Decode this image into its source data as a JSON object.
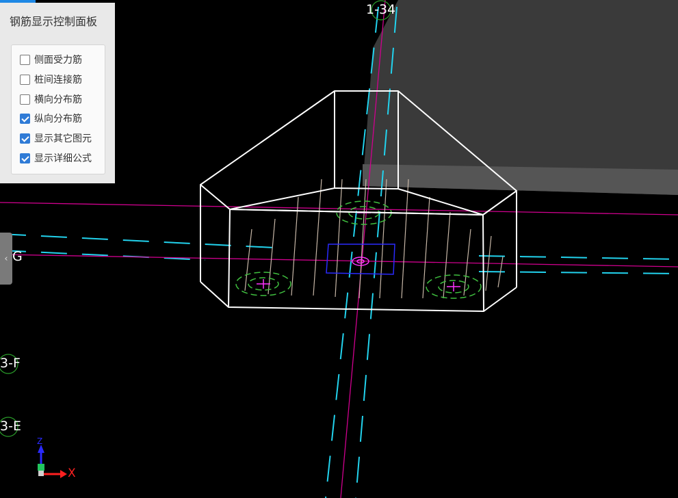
{
  "panel": {
    "title": "钢筋显示控制面板",
    "options": [
      {
        "label": "侧面受力筋",
        "checked": false
      },
      {
        "label": "桩间连接筋",
        "checked": false
      },
      {
        "label": "横向分布筋",
        "checked": false
      },
      {
        "label": "纵向分布筋",
        "checked": true
      },
      {
        "label": "显示其它图元",
        "checked": true
      },
      {
        "label": "显示详细公式",
        "checked": true
      }
    ]
  },
  "sidebar_toggle": "‹",
  "axis_labels": {
    "top": "1-34",
    "g": "G",
    "f": "3-F",
    "e": "3-E"
  },
  "gizmo": {
    "x_label": "X",
    "z_label": "Z"
  },
  "colors": {
    "background": "#000000",
    "wireframe": "#ffffff",
    "rebar": "#c8b8a8",
    "grid_cyan": "#22d3ee",
    "axis_magenta": "#d1008f",
    "pile_green": "#3fbf3f",
    "pile_center": "#ff33ff",
    "center_rect": "#2a2aff",
    "accent": "#1e88e5"
  }
}
